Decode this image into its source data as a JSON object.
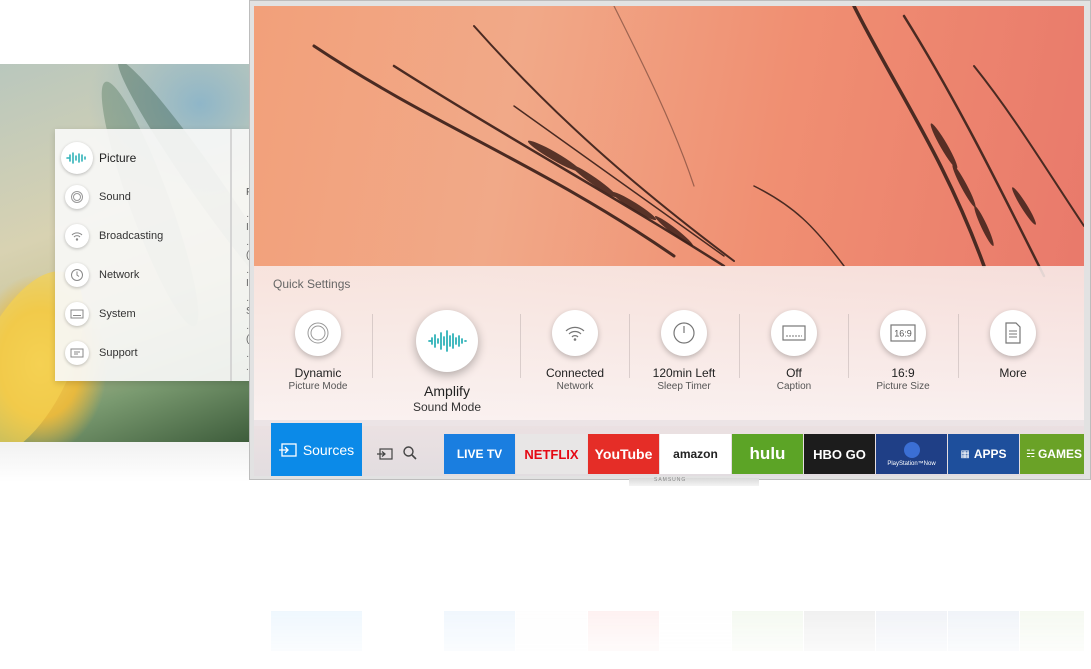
{
  "settings_menu": {
    "items": [
      {
        "label": "Picture",
        "icon": "picture-wave-icon",
        "active": true
      },
      {
        "label": "Sound",
        "icon": "sound-icon"
      },
      {
        "label": "Broadcasting",
        "icon": "broadcast-icon"
      },
      {
        "label": "Network",
        "icon": "network-icon"
      },
      {
        "label": "System",
        "icon": "system-icon"
      },
      {
        "label": "Support",
        "icon": "support-icon"
      }
    ],
    "sub_title": "Pi",
    "sub_bullets": [
      "· I",
      "· (",
      "· I",
      "· S",
      "· (",
      "· ."
    ]
  },
  "quick_settings": {
    "title": "Quick Settings",
    "items": [
      {
        "value": "Dynamic",
        "label": "Picture Mode",
        "icon": "picture-mode-icon"
      },
      {
        "value": "Amplify",
        "label": "Sound Mode",
        "icon": "sound-wave-icon",
        "focused": true
      },
      {
        "value": "Connected",
        "label": "Network",
        "icon": "wifi-icon"
      },
      {
        "value": "120min Left",
        "label": "Sleep Timer",
        "icon": "clock-icon"
      },
      {
        "value": "Off",
        "label": "Caption",
        "icon": "caption-icon"
      },
      {
        "value": "16:9",
        "label": "Picture Size",
        "icon": "aspect-ratio-icon"
      },
      {
        "value": "More",
        "label": "",
        "icon": "document-icon"
      }
    ]
  },
  "smart_bar": {
    "sources_label": "Sources",
    "apps": [
      {
        "label": "LIVE TV",
        "bg": "#1a7ee0",
        "fg": "#ffffff"
      },
      {
        "label": "NETFLIX",
        "bg": "#e8e6e6",
        "fg": "#e50914"
      },
      {
        "label": "YouTube",
        "bg": "#e52d27",
        "fg": "#ffffff"
      },
      {
        "label": "amazon",
        "bg": "#ffffff",
        "fg": "#222222"
      },
      {
        "label": "hulu",
        "bg": "#5ca426",
        "fg": "#ffffff"
      },
      {
        "label": "HBO GO",
        "bg": "#1c1c1c",
        "fg": "#ffffff"
      },
      {
        "label": "PlayStation™Now",
        "bg": "#1f3f86",
        "fg": "#ffffff"
      },
      {
        "label": "APPS",
        "bg": "#1e4f9c",
        "fg": "#ffffff"
      },
      {
        "label": "GAMES",
        "bg": "#6aa227",
        "fg": "#ffffff"
      }
    ]
  },
  "tv_brand": "SAMSUNG",
  "colors": {
    "accent": "#0b8ae8",
    "sound_wave": "#2fb2b8"
  }
}
